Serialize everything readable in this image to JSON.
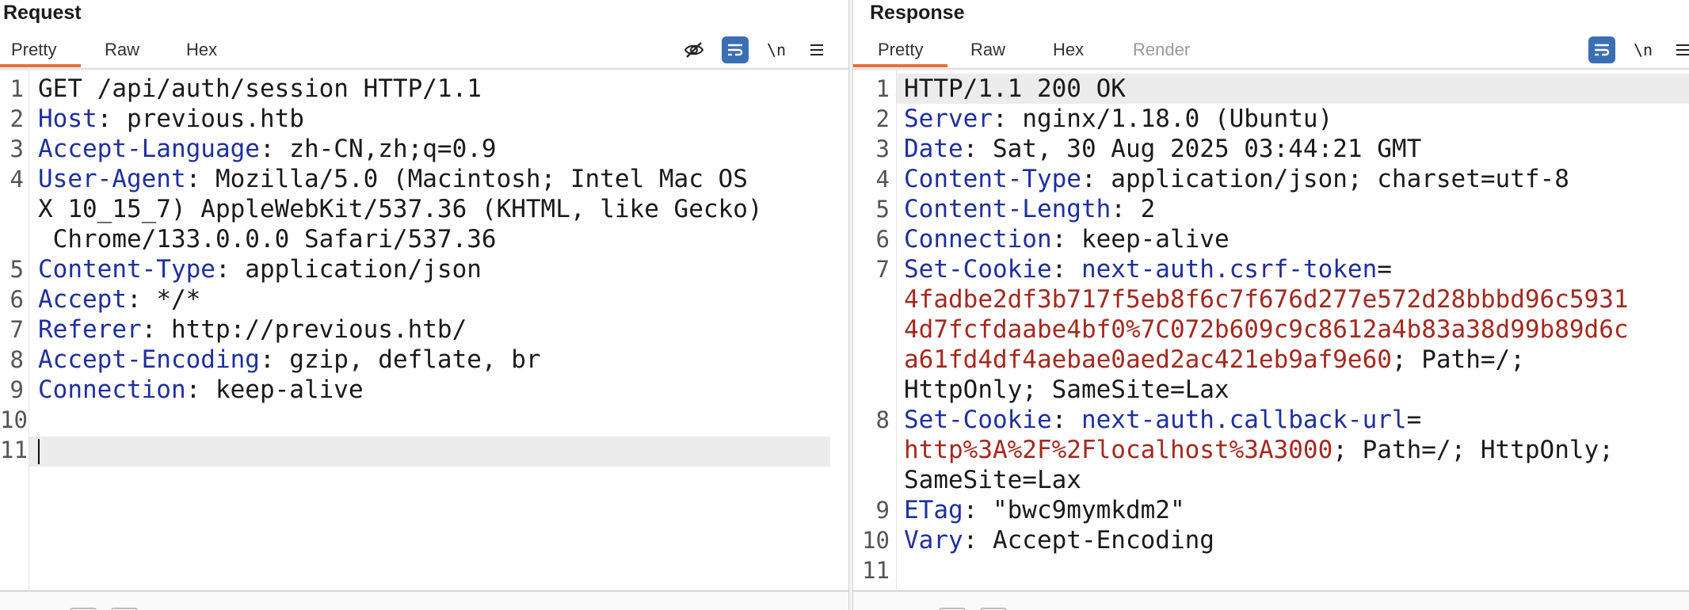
{
  "request": {
    "title": "Request",
    "tabs": [
      "Pretty",
      "Raw",
      "Hex"
    ],
    "active_tab": "Pretty",
    "toolbar": {
      "wrap": "\\n",
      "icons": [
        "eye-off-icon",
        "wrap-lines-icon",
        "newline-icon",
        "menu-icon"
      ]
    },
    "lines": [
      {
        "n": "1",
        "text": "GET /api/auth/session HTTP/1.1"
      },
      {
        "n": "2",
        "key": "Host",
        "val": "previous.htb"
      },
      {
        "n": "3",
        "key": "Accept-Language",
        "val": "zh-CN,zh;q=0.9"
      },
      {
        "n": "4",
        "key": "User-Agent",
        "val": "Mozilla/5.0 (Macintosh; Intel Mac OS"
      },
      {
        "n": "",
        "text": "X 10_15_7) AppleWebKit/537.36 (KHTML, like Gecko)"
      },
      {
        "n": "",
        "text": " Chrome/133.0.0.0 Safari/537.36"
      },
      {
        "n": "5",
        "key": "Content-Type",
        "val": "application/json"
      },
      {
        "n": "6",
        "key": "Accept",
        "val": "*/*"
      },
      {
        "n": "7",
        "key": "Referer",
        "val": "http://previous.htb/"
      },
      {
        "n": "8",
        "key": "Accept-Encoding",
        "val": "gzip, deflate, br"
      },
      {
        "n": "9",
        "key": "Connection",
        "val": "keep-alive"
      },
      {
        "n": "10",
        "text": ""
      },
      {
        "n": "11",
        "text": ""
      }
    ]
  },
  "response": {
    "title": "Response",
    "tabs": [
      "Pretty",
      "Raw",
      "Hex",
      "Render"
    ],
    "active_tab": "Pretty",
    "toolbar": {
      "wrap": "\\n",
      "icons": [
        "wrap-lines-icon",
        "newline-icon",
        "menu-icon"
      ]
    },
    "lines": [
      {
        "n": "1",
        "text": "HTTP/1.1 200 OK"
      },
      {
        "n": "2",
        "key": "Server",
        "val": "nginx/1.18.0 (Ubuntu)"
      },
      {
        "n": "3",
        "key": "Date",
        "val": "Sat, 30 Aug 2025 03:44:21 GMT"
      },
      {
        "n": "4",
        "key": "Content-Type",
        "val": "application/json; charset=utf-8"
      },
      {
        "n": "5",
        "key": "Content-Length",
        "val": "2"
      },
      {
        "n": "6",
        "key": "Connection",
        "val": "keep-alive"
      },
      {
        "n": "7",
        "key": "Set-Cookie",
        "ckey": "next-auth.csrf-token",
        "ceq": "="
      },
      {
        "n": "",
        "cval": "4fadbe2df3b717f5eb8f6c7f676d277e572d28bbbd96c5931"
      },
      {
        "n": "",
        "cval": "4d7fcfdaabe4bf0%7C072b609c9c8612a4b83a38d99b89d6c"
      },
      {
        "n": "",
        "cval": "a61fd4df4aebae0aed2ac421eb9af9e60",
        "rest": "; Path=/;"
      },
      {
        "n": "",
        "text": "HttpOnly; SameSite=Lax"
      },
      {
        "n": "8",
        "key": "Set-Cookie",
        "ckey": "next-auth.callback-url",
        "ceq": "="
      },
      {
        "n": "",
        "cval": "http%3A%2F%2Flocalhost%3A3000",
        "rest": "; Path=/; HttpOnly;"
      },
      {
        "n": "",
        "text": "SameSite=Lax"
      },
      {
        "n": "9",
        "key": "ETag",
        "val": "\"bwc9mymkdm2\""
      },
      {
        "n": "10",
        "key": "Vary",
        "val": "Accept-Encoding"
      },
      {
        "n": "11",
        "text": ""
      },
      {
        "n": "",
        "text": "{"
      }
    ]
  }
}
